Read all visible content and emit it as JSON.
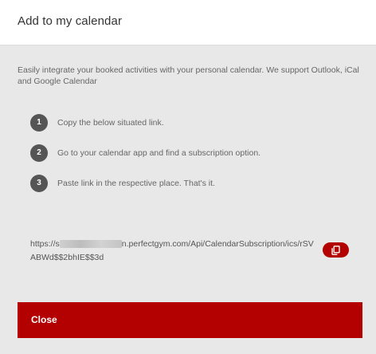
{
  "dialog": {
    "title": "Add to my calendar",
    "intro": "Easily integrate your booked activities with your personal calendar. We support Outlook, iCal and Google Calendar",
    "steps": [
      {
        "number": "1",
        "text": "Copy the below situated link."
      },
      {
        "number": "2",
        "text": "Go to your calendar app and find a subscription option."
      },
      {
        "number": "3",
        "text": "Paste link in the respective place. That's it."
      }
    ],
    "link": {
      "prefix": "https://s",
      "suffix": "n.perfectgym.com/Api/CalendarSubscription/ics/rSVABWd$$2bhIE$$3d"
    },
    "copy_icon": "copy-icon",
    "close_label": "Close"
  },
  "colors": {
    "accent": "#b30000",
    "header_bg": "#ffffff",
    "body_bg": "#e8e8e8",
    "step_circle": "#555555"
  }
}
